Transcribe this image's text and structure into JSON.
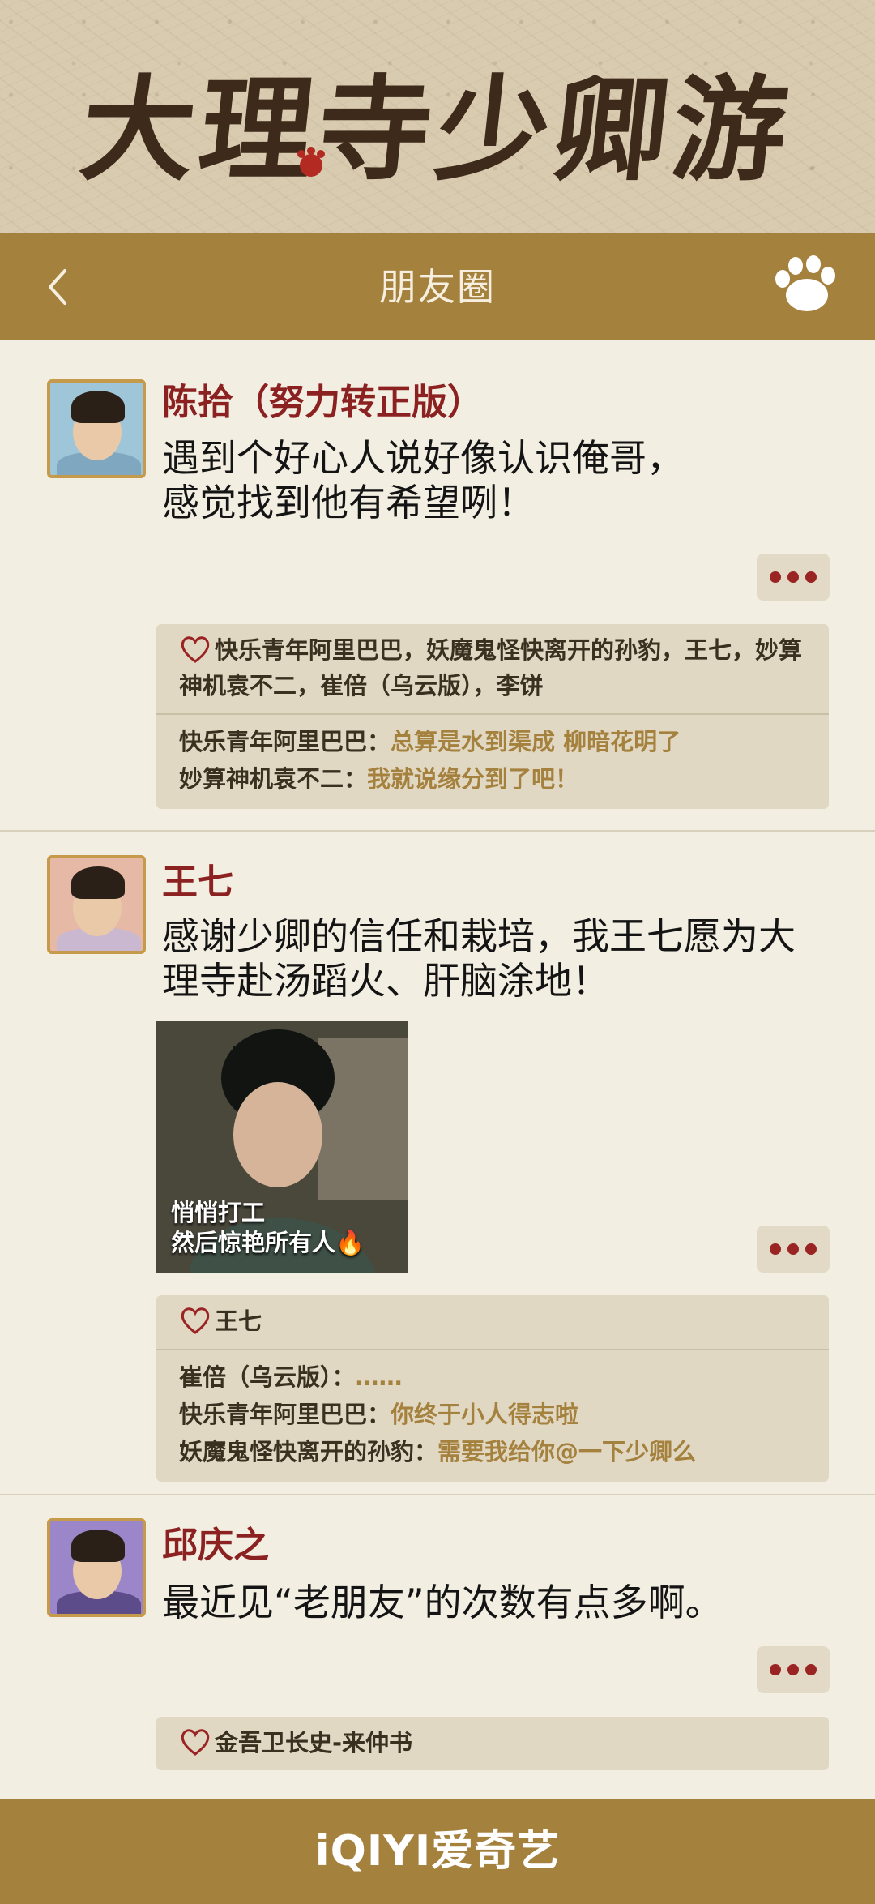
{
  "banner": {
    "title": "大理寺少卿游"
  },
  "header": {
    "title": "朋友圈"
  },
  "posts": [
    {
      "author": "陈拾（努力转正版）",
      "text": "遇到个好心人说好像认识俺哥，\n感觉找到他有希望咧！",
      "likes": "快乐青年阿里巴巴，妖魔鬼怪快离开的孙豹，王七，妙算神机袁不二，崔倍（乌云版），李饼",
      "comments": [
        {
          "name": "快乐青年阿里巴巴：",
          "text": "总算是水到渠成 柳暗花明了"
        },
        {
          "name": "妙算神机袁不二：",
          "text": "我就说缘分到了吧！"
        }
      ]
    },
    {
      "author": "王七",
      "text": "感谢少卿的信任和栽培，我王七愿为大\n理寺赴汤蹈火、肝脑涂地！",
      "photo_caption": "悄悄打工\n然后惊艳所有人🔥",
      "likes": "王七",
      "comments": [
        {
          "name": "崔倍（乌云版）：",
          "text": "……"
        },
        {
          "name": "快乐青年阿里巴巴：",
          "text": "你终于小人得志啦"
        },
        {
          "name": "妖魔鬼怪快离开的孙豹：",
          "text": "需要我给你@一下少卿么"
        }
      ]
    },
    {
      "author": "邱庆之",
      "text": "最近见“老朋友”的次数有点多啊。",
      "likes": "金吾卫长史-来仲书",
      "comments": []
    }
  ],
  "footer": {
    "logo": "iQIYI爱奇艺"
  },
  "colors": {
    "header_bg": "#a5813e",
    "author": "#8c2121",
    "comment_text": "#a5813e",
    "page_bg": "#f3eee2"
  },
  "icons": [
    "back-icon",
    "paw-icon",
    "more-icon",
    "heart-icon"
  ]
}
